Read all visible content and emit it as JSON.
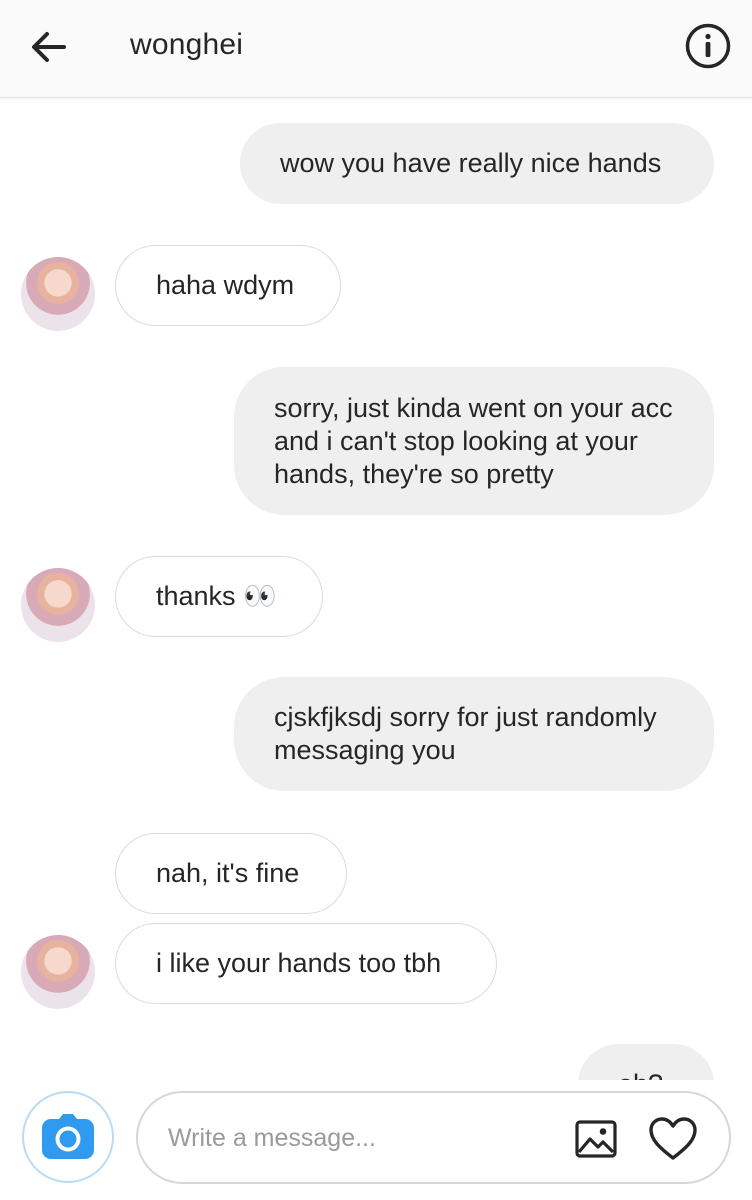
{
  "header": {
    "username": "wonghei",
    "back_icon": "arrow-left-icon",
    "info_icon": "info-icon"
  },
  "messages": [
    {
      "direction": "sent",
      "text": "wow you have really nice hands"
    },
    {
      "direction": "received",
      "text": "haha wdym"
    },
    {
      "direction": "sent",
      "text": "sorry, just kinda went on your acc and i can't stop looking at your hands, they're so pretty"
    },
    {
      "direction": "received",
      "text": "thanks 👀"
    },
    {
      "direction": "sent",
      "text": "cjskfjksdj sorry for just randomly messaging you"
    },
    {
      "direction": "received",
      "text": "nah, it's fine"
    },
    {
      "direction": "received",
      "text": "i like your hands too tbh"
    },
    {
      "direction": "sent",
      "text": "oh?"
    }
  ],
  "composer": {
    "placeholder": "Write a message...",
    "value": "",
    "camera_icon": "camera-icon",
    "gallery_icon": "image-icon",
    "like_icon": "heart-icon"
  },
  "colors": {
    "sent_bubble": "#efefef",
    "received_border": "#dbdbdb",
    "camera_accent": "#2f9bf0"
  }
}
